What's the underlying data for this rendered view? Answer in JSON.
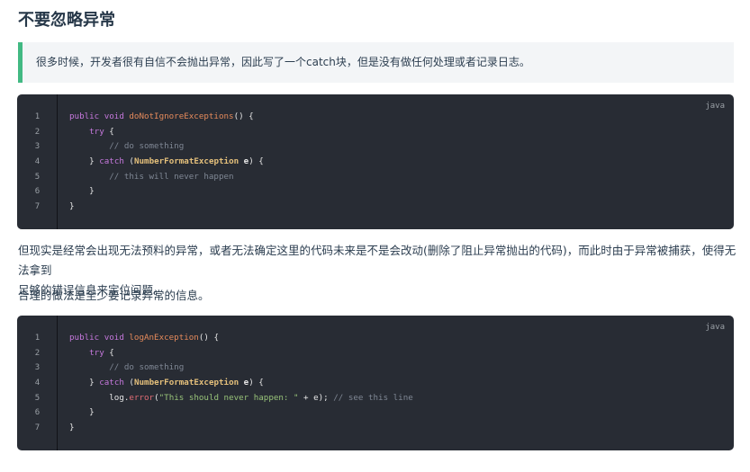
{
  "heading": "不要忽略异常",
  "tip": "很多时候，开发者很有自信不会抛出异常，因此写了一个catch块，但是没有做任何处理或者记录日志。",
  "para1_line1": "但现实是经常会出现无法预料的异常，或者无法确定这里的代码未来是不是会改动(删除了阻止异常抛出的代码)，而此时由于异常被捕获，使得无法拿到",
  "para1_line2": "足够的错误信息来定位问题。",
  "para2": "合理的做法是至少要记录异常的信息。",
  "code1": {
    "lang": "java",
    "line_numbers": [
      "1",
      "2",
      "3",
      "4",
      "5",
      "6",
      "7"
    ],
    "l1": {
      "kw": "public void ",
      "fn": "doNotIgnoreExceptions",
      "rest": "() {"
    },
    "l2": {
      "indent": "    ",
      "kw": "try",
      "rest": " {"
    },
    "l3": {
      "indent": "        ",
      "comment": "// do something"
    },
    "l4": {
      "indent": "    ",
      "brace": "} ",
      "kw": "catch",
      "open": " (",
      "cls": "NumberFormatException",
      "var": " e",
      "rest": ") {"
    },
    "l5": {
      "indent": "        ",
      "comment": "// this will never happen"
    },
    "l6": {
      "indent": "    ",
      "rest": "}"
    },
    "l7": {
      "rest": "}"
    }
  },
  "code2": {
    "lang": "java",
    "line_numbers": [
      "1",
      "2",
      "3",
      "4",
      "5",
      "6",
      "7"
    ],
    "l1": {
      "kw": "public void ",
      "fn": "logAnException",
      "rest": "() {"
    },
    "l2": {
      "indent": "    ",
      "kw": "try",
      "rest": " {"
    },
    "l3": {
      "indent": "        ",
      "comment": "// do something"
    },
    "l4": {
      "indent": "    ",
      "brace": "} ",
      "kw": "catch",
      "open": " (",
      "cls": "NumberFormatException",
      "var": " e",
      "rest": ") {"
    },
    "l5": {
      "indent": "        ",
      "obj": "log.",
      "method": "error",
      "open": "(",
      "str": "\"This should never happen: \"",
      "mid": " + e); ",
      "comment": "// see this line"
    },
    "l6": {
      "indent": "    ",
      "rest": "}"
    },
    "l7": {
      "rest": "}"
    }
  },
  "colors": {
    "accent": "#42b983",
    "code_bg": "#282c34",
    "keyword": "#c678dd",
    "function": "#e58a5b",
    "class": "#e5c07b",
    "comment": "#7f8794",
    "string": "#98c379"
  }
}
